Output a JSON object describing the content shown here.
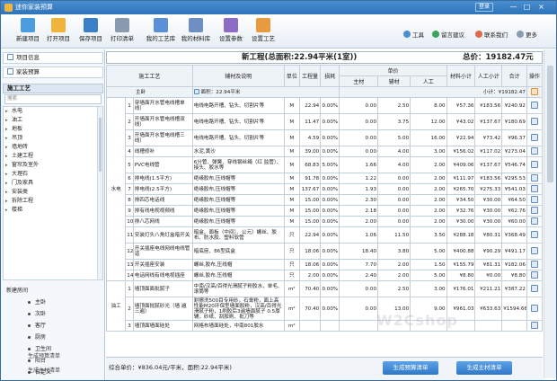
{
  "window": {
    "title": "迷你家装预算",
    "login": "登录",
    "min": "—",
    "max": "□",
    "close": "×"
  },
  "toolbar": {
    "buttons": [
      "新建项目",
      "打开项目",
      "保存项目",
      "打印清单",
      "我的工艺库",
      "我的材料库",
      "设置参数",
      "设置工艺"
    ],
    "right": [
      "工具",
      "留言建议",
      "联系我们",
      "更多"
    ]
  },
  "left": {
    "project_info": "项目信息",
    "home_budget": "家装预算",
    "category": "施工工艺",
    "search_placeholder": "搜索",
    "items": [
      "水电",
      "油工",
      "地板",
      "吊顶",
      "墙地砖",
      "土建工程",
      "窗帘及室外",
      "大理石",
      "门及家具",
      "安装类",
      "拆除工程",
      "楼梯"
    ],
    "rooms_head": "新建房间",
    "rooms": [
      "主卧",
      "次卧",
      "客厅",
      "厨房",
      "卫生间",
      "阳台",
      "自定义"
    ],
    "actions": [
      "生成预算清单",
      "生成主材清单"
    ]
  },
  "main": {
    "title": "新工程(总面积:22.94平米(1室))",
    "total": "总价：19182.47元",
    "headers": {
      "craft": "施工工艺",
      "material": "辅材及说明",
      "unit": "单位",
      "qty": "工程量",
      "loss": "损耗",
      "price": "单价",
      "main_mat": "主材",
      "aux": "辅材",
      "labor": "人工",
      "mat_sub": "材料小计",
      "labor_sub": "人工小计",
      "total": "合计",
      "op": "操作"
    },
    "room": {
      "name": "主卧",
      "area": "面积：22.94平米",
      "subtotal": "小计：¥19182.47"
    },
    "group1": "水电",
    "group2": "油工",
    "rows": [
      {
        "no": "1",
        "name": "穿墙面开水管电线槽单线）",
        "desc": "电线电路开槽、钻头、切割片等",
        "unit": "M",
        "qty": "22.94",
        "loss": "0.00%",
        "main": "0.00",
        "aux": "2.50",
        "labor": "8.00",
        "ms": "¥57.36",
        "ls": "¥183.56",
        "tt": "¥240.92"
      },
      {
        "no": "2",
        "name": "开墙面开水管电线槽双线）",
        "desc": "电线电路开槽、钻头、切割片等",
        "unit": "M",
        "qty": "11.47",
        "loss": "0.00%",
        "main": "0.00",
        "aux": "3.75",
        "labor": "12.00",
        "ms": "¥43.02",
        "ls": "¥137.67",
        "tt": "¥180.69"
      },
      {
        "no": "3",
        "name": "开墙面开水管电线槽三线）",
        "desc": "电线电路开槽、钻头、切割片等",
        "unit": "M",
        "qty": "4.59",
        "loss": "0.00%",
        "main": "0.00",
        "aux": "5.00",
        "labor": "16.00",
        "ms": "¥22.94",
        "ls": "¥73.42",
        "tt": "¥96.37"
      },
      {
        "no": "4",
        "name": "线槽修补",
        "desc": "水泥,黄沙",
        "unit": "M",
        "qty": "39.00",
        "loss": "0.00%",
        "main": "0.00",
        "aux": "4.00",
        "labor": "3.00",
        "ms": "¥156.02",
        "ls": "¥117.02",
        "tt": "¥273.04"
      },
      {
        "no": "5",
        "name": "PVC电线管",
        "desc": "6分管、弹簧、穿线钢丝绳（红 监管）、接头、胶水等",
        "unit": "M",
        "qty": "68.83",
        "loss": "5.00%",
        "main": "1.66",
        "aux": "4.00",
        "labor": "2.00",
        "ms": "¥409.06",
        "ls": "¥137.67",
        "tt": "¥546.74"
      },
      {
        "no": "6",
        "name": "排电线(1.5平方)",
        "desc": "绝缘胶布,压线帽等",
        "unit": "M",
        "qty": "91.78",
        "loss": "0.00%",
        "main": "1.22",
        "aux": "0.00",
        "labor": "2.00",
        "ms": "¥111.97",
        "ls": "¥183.56",
        "tt": "¥295.53"
      },
      {
        "no": "7",
        "name": "排电线(2.5平方)",
        "desc": "绝缘胶布,压线帽等",
        "unit": "M",
        "qty": "137.67",
        "loss": "0.00%",
        "main": "1.93",
        "aux": "0.00",
        "labor": "2.00",
        "ms": "¥265.70",
        "ls": "¥275.33",
        "tt": "¥541.03"
      },
      {
        "no": "8",
        "name": "排四芯电话线",
        "desc": "绝缘胶布,压线帽等",
        "unit": "M",
        "qty": "15.00",
        "loss": "0.00%",
        "main": "2.30",
        "aux": "0.00",
        "labor": "2.00",
        "ms": "¥34.50",
        "ls": "¥30.00",
        "tt": "¥64.50"
      },
      {
        "no": "9",
        "name": "排有线电视视频线",
        "desc": "绝缘胶布,压线帽等",
        "unit": "M",
        "qty": "15.00",
        "loss": "0.00%",
        "main": "2.18",
        "aux": "0.00",
        "labor": "2.00",
        "ms": "¥32.76",
        "ls": "¥30.00",
        "tt": "¥62.76"
      },
      {
        "no": "10",
        "name": "排八芯网线",
        "desc": "绝缘胶布,压线帽等",
        "unit": "M",
        "qty": "15.00",
        "loss": "0.00%",
        "main": "2.00",
        "aux": "0.00",
        "labor": "2.00",
        "ms": "¥30.00",
        "ls": "¥30.00",
        "tt": "¥60.00"
      },
      {
        "no": "11",
        "name": "安装灯头八角灯盒暗开关",
        "desc": "暗盒、面板（中间）、公元）螺丝、胶布、防水胶、塑料软管",
        "unit": "只",
        "qty": "22.94",
        "loss": "0.00%",
        "main": "1.06",
        "aux": "11.50",
        "labor": "3.50",
        "ms": "¥288.18",
        "ls": "¥80.31",
        "tt": "¥368.49"
      },
      {
        "no": "12",
        "name": "开关插座电线网线电线管道",
        "desc": "暗底座、86型底盒",
        "unit": "只",
        "qty": "18.06",
        "loss": "0.00%",
        "main": "18.40",
        "aux": "3.80",
        "labor": "5.00",
        "ms": "¥400.88",
        "ls": "¥90.29",
        "tt": "¥491.17"
      },
      {
        "no": "13",
        "name": "开关插座安装",
        "desc": "螺丝,胶布,压线帽",
        "unit": "只",
        "qty": "18.06",
        "loss": "0.00%",
        "main": "7.70",
        "aux": "2.00",
        "labor": "1.50",
        "ms": "¥155.79",
        "ls": "¥81.31",
        "tt": "¥182.06"
      },
      {
        "no": "14",
        "name": "电话网线有线电视插座",
        "desc": "螺丝,胶布,压线帽",
        "unit": "只",
        "qty": "2.00",
        "loss": "0.00%",
        "main": "2.40",
        "aux": "2.00",
        "labor": "5.00",
        "ms": "¥8.80",
        "ls": "¥0.00",
        "tt": "¥8.80"
      },
      {
        "no": "1",
        "name": "墙顶面面批腻子",
        "desc": "中南/汉高/百得光滑腻子粉胶水，单毛、滚筒等",
        "unit": "m²",
        "qty": "70.40",
        "loss": "0.00%",
        "main": "0.00",
        "aux": "2.50",
        "labor": "3.00",
        "ms": "¥176.01",
        "ls": "¥211.21",
        "tt": "¥387.22"
      },
      {
        "no": "2",
        "name": "墙顶面批腻砂光（墙 遍三遍）",
        "desc": "耐擦洗500目专用砂，石膏粉，面上高性能M20环保型墙面胶粉，汉高/百得光滑腻子粉，1刷胶后3遍墙面腻子 0.5厚辅，砂纸、刮胶刷、批刀等",
        "unit": "m²",
        "qty": "70.40",
        "loss": "0.00%",
        "main": "0.00",
        "aux": "13.00",
        "labor": "9.00",
        "ms": "¥961.03",
        "ls": "¥633.63",
        "tt": "¥1594.66"
      },
      {
        "no": "3",
        "name": "墙顶面墙面硅处",
        "desc": "网格布墙面硅处，中南801胶水",
        "unit": "m²",
        "qty": "",
        "loss": "",
        "main": "",
        "aux": "",
        "labor": "",
        "ms": "",
        "ls": "",
        "tt": ""
      }
    ]
  },
  "footer": {
    "summary": "综合单价：¥836.04元/平米，面积:22.94平米)",
    "btn1": "生成预算清单",
    "btn2": "生成主材清单"
  },
  "watermark": "W2Cshop"
}
